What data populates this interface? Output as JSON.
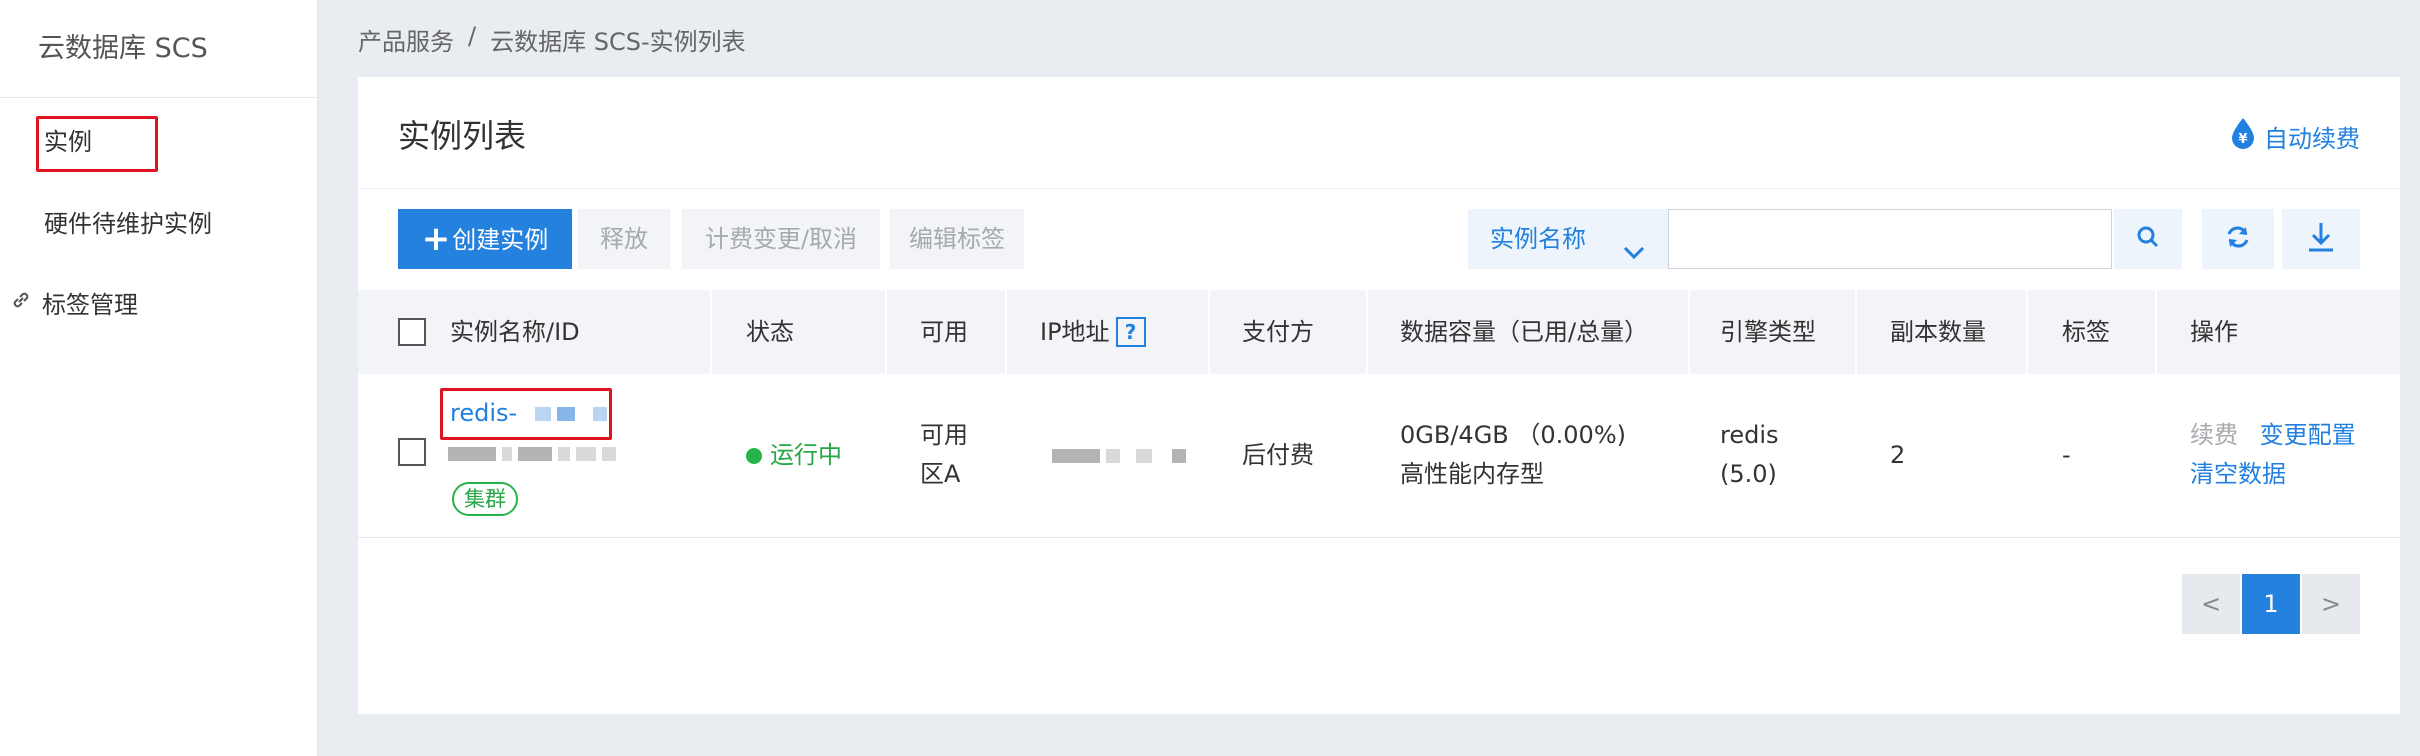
{
  "sidebar": {
    "title": "云数据库 SCS",
    "items": [
      {
        "label": "实例"
      },
      {
        "label": "硬件待维护实例"
      },
      {
        "label": "标签管理"
      }
    ]
  },
  "breadcrumb": {
    "root": "产品服务",
    "sep": "/",
    "current": "云数据库 SCS-实例列表"
  },
  "main": {
    "title": "实例列表",
    "auto_renew": "自动续费",
    "toolbar": {
      "create": "创建实例",
      "release": "释放",
      "billing_change": "计费变更/取消",
      "edit_tags": "编辑标签",
      "search_type": "实例名称",
      "search_placeholder": ""
    },
    "table": {
      "headers": {
        "name": "实例名称/ID",
        "status": "状态",
        "zone": "可用",
        "ip": "IP地址",
        "ip_help": "?",
        "payment": "支付方",
        "capacity": "数据容量（已用/总量）",
        "engine": "引擎类型",
        "replicas": "副本数量",
        "tags": "标签",
        "actions": "操作"
      },
      "rows": [
        {
          "name": "redis-",
          "badge": "集群",
          "status": "运行中",
          "zone_line1": "可用",
          "zone_line2": "区A",
          "payment": "后付费",
          "capacity_line1": "0GB/4GB （0.00%)",
          "capacity_line2": "高性能内存型",
          "engine_line1": "redis",
          "engine_line2": "(5.0)",
          "replicas": "2",
          "tags": "-",
          "action_renew": "续费",
          "action_change": "变更配置",
          "action_clear": "清空数据"
        }
      ]
    },
    "pagination": {
      "prev": "<",
      "page": "1",
      "next": ">"
    }
  },
  "colors": {
    "primary": "#2481de",
    "link": "#2180e0",
    "success": "#28a745",
    "highlight": "#e0141e"
  }
}
